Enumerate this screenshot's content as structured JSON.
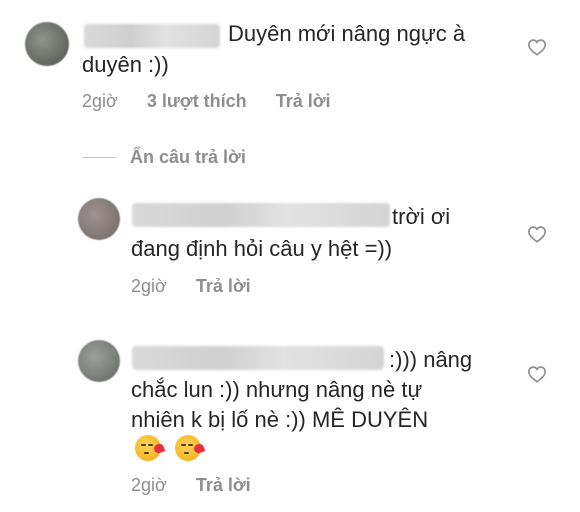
{
  "comments": [
    {
      "text_line1": "Duyên mới nâng ngực à",
      "text_line2": "duyên :))",
      "time": "2giờ",
      "likes": "3 lượt thích",
      "reply": "Trả lời"
    }
  ],
  "hide_replies_label": "Ẩn câu trả lời",
  "replies": [
    {
      "text_line1": "trời ơi",
      "text_line2": "đang định hỏi câu y hệt =))",
      "time": "2giờ",
      "reply": "Trả lời"
    },
    {
      "text_line1": ":))) nâng",
      "text_line2": "chắc lun :)) nhưng nâng nè tự",
      "text_line3": "nhiên k bị lố nè :)) MÊ DUYÊN",
      "emojis": [
        "kissing-heart",
        "kissing-heart"
      ],
      "time": "2giờ",
      "reply": "Trả lời"
    }
  ],
  "colors": {
    "text": "#262626",
    "meta": "#8e8e8e",
    "divider": "#c7c7c7"
  }
}
